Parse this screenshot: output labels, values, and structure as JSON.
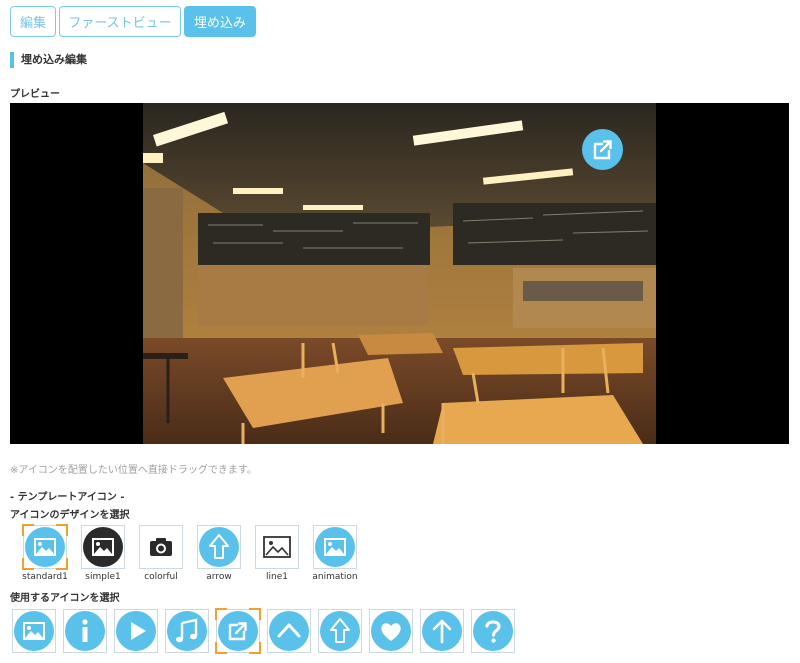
{
  "tabs": [
    {
      "label": "編集",
      "active": false
    },
    {
      "label": "ファーストビュー",
      "active": false
    },
    {
      "label": "埋め込み",
      "active": true
    }
  ],
  "section_title": "埋め込み編集",
  "preview_label": "プレビュー",
  "note": "※アイコンを配置したい位置へ直接ドラッグできます。",
  "template_heading": "- テンプレートアイコン -",
  "design_heading": "アイコンのデザインを選択",
  "designs": [
    {
      "name": "standard1",
      "icon": "image-icon",
      "selected": true
    },
    {
      "name": "simple1",
      "icon": "image-icon",
      "selected": false
    },
    {
      "name": "colorful",
      "icon": "camera-icon",
      "selected": false
    },
    {
      "name": "arrow",
      "icon": "up-arrow-icon",
      "selected": false
    },
    {
      "name": "line1",
      "icon": "image-icon",
      "selected": false
    },
    {
      "name": "animation",
      "icon": "image-icon",
      "selected": false
    }
  ],
  "use_heading": "使用するアイコンを選択",
  "use_icons": [
    {
      "icon": "image-icon",
      "selected": false
    },
    {
      "icon": "info-icon",
      "selected": false
    },
    {
      "icon": "play-icon",
      "selected": false
    },
    {
      "icon": "music-icon",
      "selected": false
    },
    {
      "icon": "external-link-icon",
      "selected": true
    },
    {
      "icon": "chevron-up-icon",
      "selected": false
    },
    {
      "icon": "up-arrow-icon",
      "selected": false
    },
    {
      "icon": "heart-icon",
      "selected": false
    },
    {
      "icon": "arrow-up-icon",
      "selected": false
    },
    {
      "icon": "question-icon",
      "selected": false
    }
  ],
  "colors": {
    "accent": "#5ac1ea",
    "selection": "#f0a030",
    "dark": "#2b2b2b"
  }
}
